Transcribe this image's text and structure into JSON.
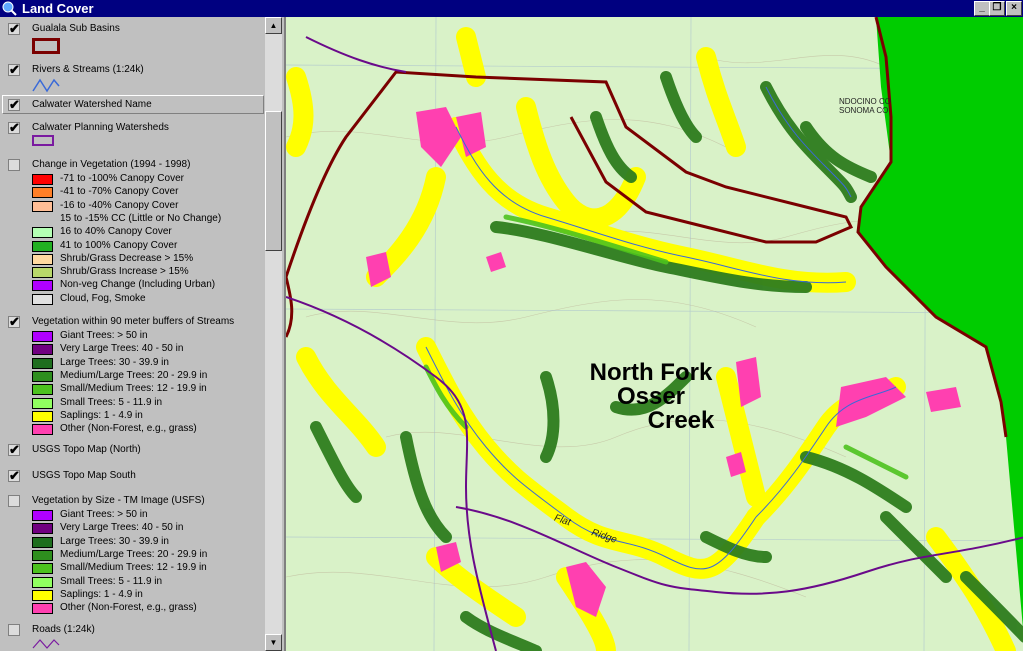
{
  "window": {
    "title": "Land Cover",
    "controls": [
      "_",
      "❐",
      "×"
    ]
  },
  "toc": {
    "layers": [
      {
        "title": "Gualala Sub Basins",
        "checked": true
      },
      {
        "title": "Rivers & Streams (1:24k)",
        "checked": true
      },
      {
        "title": "Calwater Watershed Name",
        "checked": true
      },
      {
        "title": "Calwater Planning Watersheds",
        "checked": true
      },
      {
        "title": "Change in Vegetation (1994 - 1998)",
        "checked": false,
        "classes": [
          {
            "label": "-71 to -100% Canopy Cover",
            "color": "#ff0000"
          },
          {
            "label": "-41 to -70% Canopy Cover",
            "color": "#ff7f27"
          },
          {
            "label": "-16 to -40% Canopy Cover",
            "color": "#ffbe96"
          },
          {
            "label": "15 to -15% CC (Little or No Change)",
            "color": ""
          },
          {
            "label": "16 to 40% Canopy Cover",
            "color": "#b4ffb4"
          },
          {
            "label": "41 to 100% Canopy Cover",
            "color": "#22b022"
          },
          {
            "label": "Shrub/Grass Decrease > 15%",
            "color": "#ffd9a0"
          },
          {
            "label": "Shrub/Grass Increase > 15%",
            "color": "#b8d86a"
          },
          {
            "label": "Non-veg Change (Including Urban)",
            "color": "#b000ff"
          },
          {
            "label": "Cloud, Fog, Smoke",
            "color": "#e0e0e0"
          }
        ]
      },
      {
        "title": "Vegetation within 90 meter buffers of Streams",
        "checked": true,
        "classes": [
          {
            "label": "Giant Trees: > 50 in",
            "color": "#b000ff"
          },
          {
            "label": "Very Large Trees: 40 - 50 in",
            "color": "#700080"
          },
          {
            "label": "Large Trees: 30 - 39.9 in",
            "color": "#1e6e1e"
          },
          {
            "label": "Medium/Large Trees: 20 - 29.9 in",
            "color": "#2e8e1e"
          },
          {
            "label": "Small/Medium Trees: 12 - 19.9 in",
            "color": "#4cc21e"
          },
          {
            "label": "Small Trees: 5 - 11.9 in",
            "color": "#90ff60"
          },
          {
            "label": "Saplings: 1 - 4.9 in",
            "color": "#ffff00"
          },
          {
            "label": "Other (Non-Forest, e.g., grass)",
            "color": "#ff40b0"
          }
        ]
      },
      {
        "title": "USGS Topo Map (North)",
        "checked": true
      },
      {
        "title": "USGS Topo Map South",
        "checked": true
      },
      {
        "title": "Vegetation by Size - TM Image (USFS)",
        "checked": false,
        "classes": [
          {
            "label": "Giant Trees: > 50 in",
            "color": "#b000ff"
          },
          {
            "label": "Very Large Trees: 40 - 50 in",
            "color": "#700080"
          },
          {
            "label": "Large Trees: 30 - 39.9 in",
            "color": "#1e6e1e"
          },
          {
            "label": "Medium/Large Trees: 20 - 29.9 in",
            "color": "#2e8e1e"
          },
          {
            "label": "Small/Medium Trees: 12 - 19.9 in",
            "color": "#4cc21e"
          },
          {
            "label": "Small Trees: 5 - 11.9 in",
            "color": "#90ff60"
          },
          {
            "label": "Saplings: 1 - 4.9 in",
            "color": "#ffff00"
          },
          {
            "label": "Other (Non-Forest, e.g., grass)",
            "color": "#ff40b0"
          }
        ]
      },
      {
        "title": "Roads (1:24k)",
        "checked": false
      }
    ]
  },
  "map": {
    "label_line1": "North Fork",
    "label_line2": "Osser",
    "label_line3": "Creek",
    "county_line1": "NDOCINO CO",
    "county_line2": "SONOMA CO",
    "road_label1": "Flat",
    "road_label2": "Ridge",
    "colors": {
      "topo": "#d9f2c8",
      "ocean": "#00cc00",
      "basin": "#7a0000",
      "road": "#6a0a8a",
      "stream": "#3a6ad8"
    }
  }
}
